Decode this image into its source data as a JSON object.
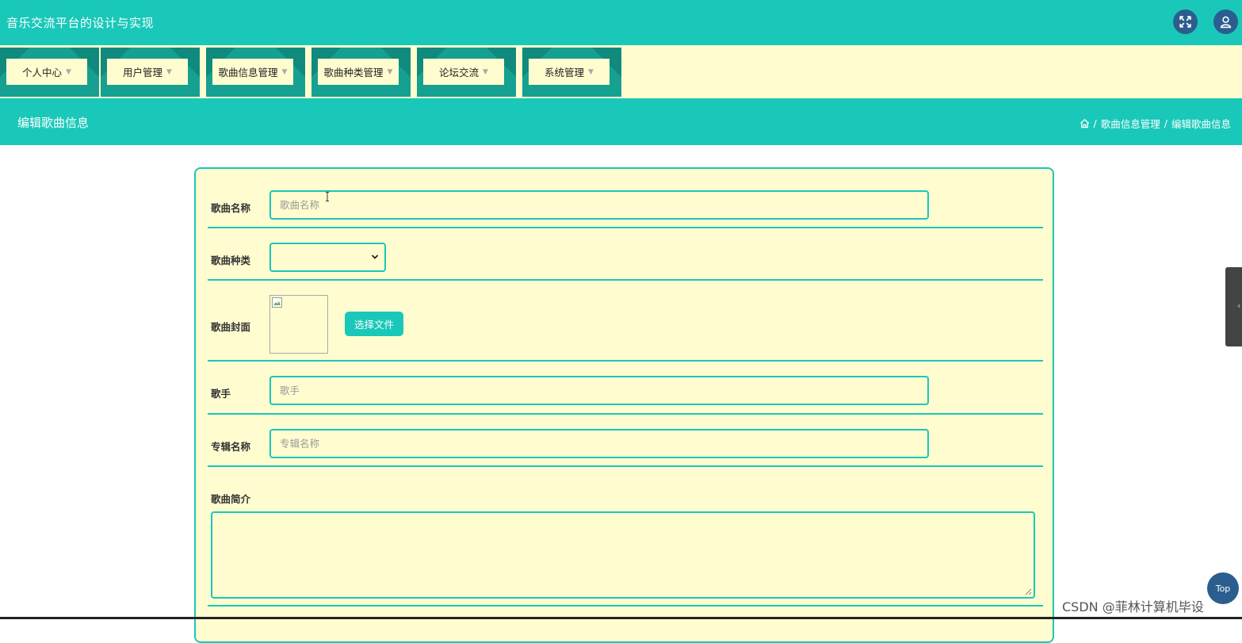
{
  "header": {
    "app_title": "音乐交流平台的设计与实现",
    "fullscreen_icon": "fullscreen-icon",
    "user_icon": "user-icon"
  },
  "nav": {
    "items": [
      {
        "label": "个人中心"
      },
      {
        "label": "用户管理"
      },
      {
        "label": "歌曲信息管理"
      },
      {
        "label": "歌曲种类管理"
      },
      {
        "label": "论坛交流"
      },
      {
        "label": "系统管理"
      }
    ]
  },
  "page": {
    "title": "编辑歌曲信息",
    "breadcrumb": [
      "歌曲信息管理",
      "编辑歌曲信息"
    ],
    "breadcrumb_sep": "/"
  },
  "form": {
    "song_name": {
      "label": "歌曲名称",
      "placeholder": "歌曲名称",
      "value": ""
    },
    "song_type": {
      "label": "歌曲种类",
      "value": ""
    },
    "cover": {
      "label": "歌曲封面",
      "button": "选择文件"
    },
    "singer": {
      "label": "歌手",
      "placeholder": "歌手",
      "value": ""
    },
    "album": {
      "label": "专辑名称",
      "placeholder": "专辑名称",
      "value": ""
    },
    "intro": {
      "label": "歌曲简介",
      "value": ""
    }
  },
  "floating": {
    "top_button": "Top",
    "watermark": "CSDN @菲林计算机毕设"
  },
  "colors": {
    "accent": "#19c8b9",
    "card_bg": "#fffdd0",
    "nav_dark": "#0f8a7c",
    "circle_btn": "#2c5d8f"
  }
}
